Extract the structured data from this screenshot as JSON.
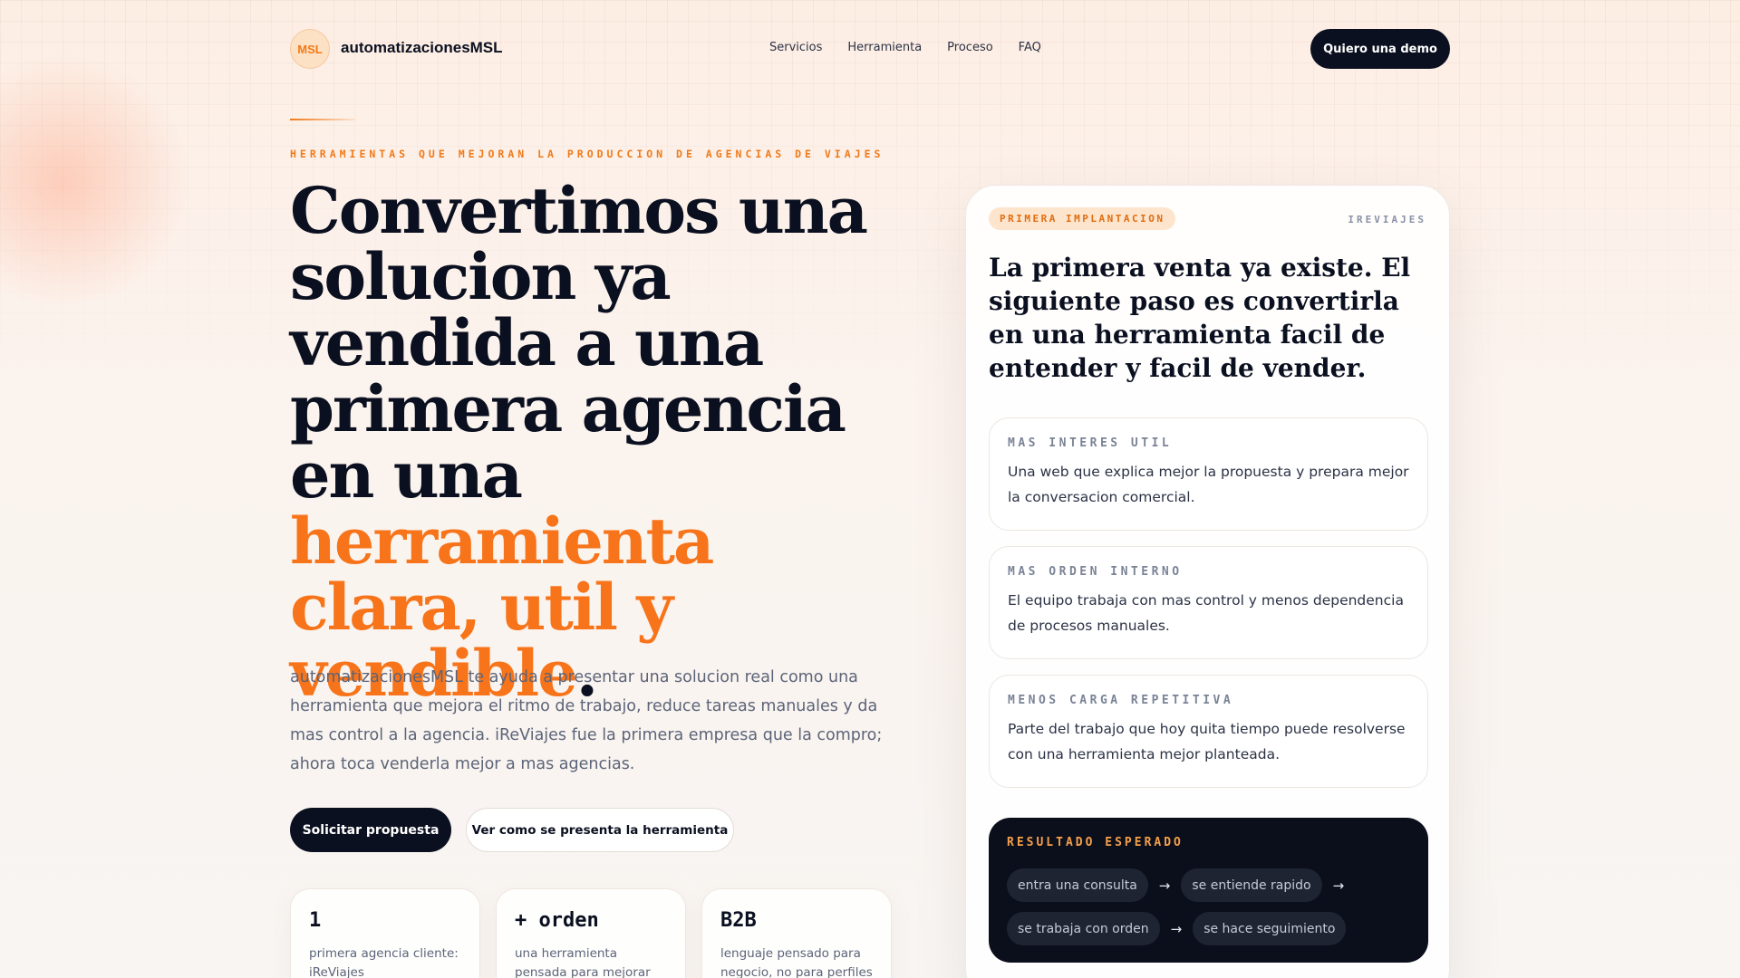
{
  "header": {
    "logo_text": "MSL",
    "brand": "automatizacionesMSL",
    "nav": [
      "Servicios",
      "Herramienta",
      "Proceso",
      "FAQ"
    ],
    "cta": "Quiero una demo"
  },
  "hero": {
    "eyebrow": "HERRAMIENTAS QUE MEJORAN LA PRODUCCION DE AGENCIAS DE VIAJES",
    "title_main": "Convertimos una solucion ya vendida a una primera agencia en una",
    "title_highlight": "herramienta clara, util y vendible",
    "title_end": ".",
    "description": "automatizacionesMSL te ayuda a presentar una solucion real como una herramienta que mejora el ritmo de trabajo, reduce tareas manuales y da mas control a la agencia. iReViajes fue la primera empresa que la compro; ahora toca venderla mejor a mas agencias.",
    "cta_primary": "Solicitar propuesta",
    "cta_secondary": "Ver como se presenta la herramienta"
  },
  "stats": [
    {
      "value": "1",
      "label": "primera agencia cliente: iReViajes"
    },
    {
      "value": "+ orden",
      "label": "una herramienta pensada para mejorar"
    },
    {
      "value": "B2B",
      "label": "lenguaje pensado para negocio, no para perfiles"
    }
  ],
  "card": {
    "tag": "PRIMERA IMPLANTACION",
    "client": "IREVIAJES",
    "title": "La primera venta ya existe. El siguiente paso es convertirla en una herramienta facil de entender y facil de vender.",
    "benefits": [
      {
        "title": "MAS INTERES UTIL",
        "text": "Una web que explica mejor la propuesta y prepara mejor la conversacion comercial."
      },
      {
        "title": "MAS ORDEN INTERNO",
        "text": "El equipo trabaja con mas control y menos dependencia de procesos manuales."
      },
      {
        "title": "MENOS CARGA REPETITIVA",
        "text": "Parte del trabajo que hoy quita tiempo puede resolverse con una herramienta mejor planteada."
      }
    ],
    "result": {
      "title": "RESULTADO ESPERADO",
      "steps": [
        "entra una consulta",
        "se entiende rapido",
        "se trabaja con orden",
        "se hace seguimiento"
      ],
      "arrow": "→"
    }
  },
  "colors": {
    "accent": "#f7741a",
    "dark": "#0b1020"
  }
}
